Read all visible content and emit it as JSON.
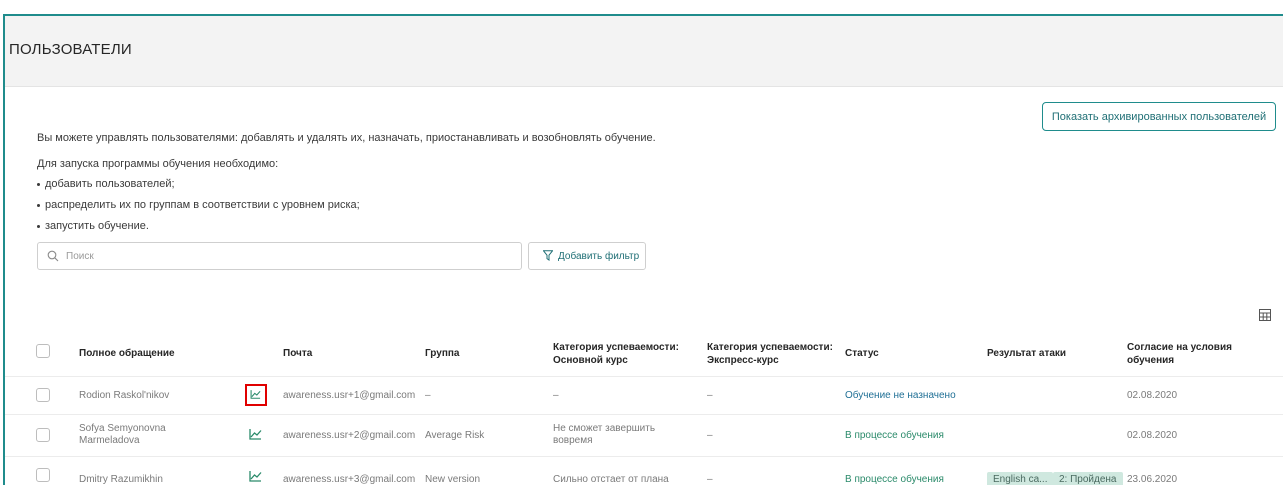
{
  "page": {
    "title": "ПОЛЬЗОВАТЕЛИ"
  },
  "intro": {
    "line1": "Вы можете управлять пользователями: добавлять и удалять их, назначать, приостанавливать и возобновлять обучение.",
    "line2": "Для запуска программы обучения необходимо:",
    "steps": [
      "добавить пользователей;",
      "распределить их по группам в соответствии с уровнем риска;",
      "запустить обучение."
    ]
  },
  "toolbar": {
    "archived_label": "Показать архивированных пользователей",
    "search_placeholder": "Поиск",
    "filter_label": "Добавить фильтр"
  },
  "table": {
    "headers": {
      "name": "Полное обращение",
      "email": "Почта",
      "group": "Группа",
      "category_main": [
        "Категория успеваемости:",
        "Основной курс"
      ],
      "category_express": [
        "Категория успеваемости:",
        "Экспресс-курс"
      ],
      "status": "Статус",
      "attack": "Результат атаки",
      "consent": [
        "Согласие на условия",
        "обучения"
      ]
    },
    "rows": [
      {
        "name": [
          "Rodion Raskol'nikov"
        ],
        "email": "awareness.usr+1@gmail.com",
        "group": "–",
        "category_main": [
          "–"
        ],
        "category_express": "–",
        "status": "Обучение не назначено",
        "attack_tags": [],
        "consent": "02.08.2020"
      },
      {
        "name": [
          "Sofya Semyonovna",
          "Marmeladova"
        ],
        "email": "awareness.usr+2@gmail.com",
        "group": "Average Risk",
        "category_main": [
          "Не сможет завершить",
          "вовремя"
        ],
        "category_express": "–",
        "status": "В процессе обучения",
        "attack_tags": [],
        "consent": "02.08.2020"
      },
      {
        "name": [
          "Dmitry Razumikhin"
        ],
        "email": "awareness.usr+3@gmail.com",
        "group": "New version",
        "category_main": [
          "Сильно отстает от плана"
        ],
        "category_express": "–",
        "status": "В процессе обучения",
        "attack_tags": [
          "English ca...",
          "2: Пройдена"
        ],
        "consent": "23.06.2020"
      }
    ]
  },
  "colors": {
    "accent": "#1f8c8c",
    "link": "#1f6f95",
    "status_in_progress": "#2a8a6a",
    "highlight": "#e00000"
  },
  "icons": [
    "search-icon",
    "filter-icon",
    "columns-icon",
    "statistics-icon"
  ]
}
